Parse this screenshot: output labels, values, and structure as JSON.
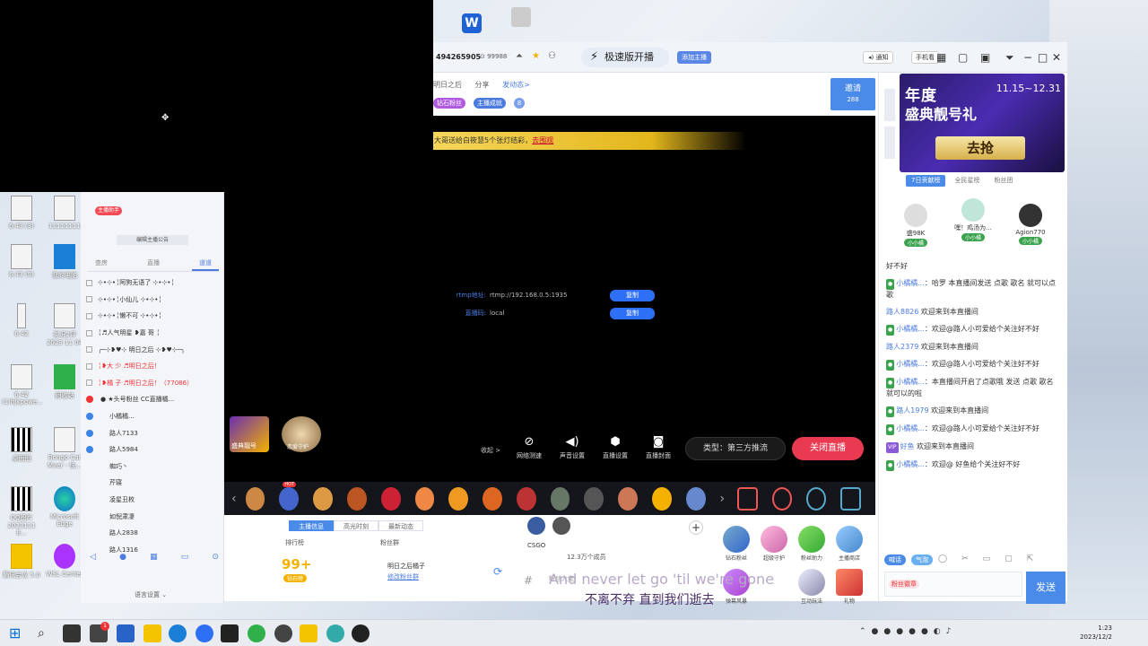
{
  "top_bar": {
    "room_id": "494265905",
    "fans_count": "99988",
    "speed_broadcast": "极速版开播",
    "add_anchor": "添加主播",
    "notice": "通知",
    "phone": "手机看"
  },
  "stream_info": {
    "title": "明日之后",
    "share": "分享",
    "publish": "发动态>",
    "badge_fans": "钻石粉丝",
    "badge_task": "主播成就",
    "badge_count": "8",
    "invite_label": "邀请",
    "invite_count": "288"
  },
  "video": {
    "banner_text": "大哥送给白筱慧5个张灯结彩，",
    "banner_link": "去围观",
    "rtmp_label": "rtmp地址:",
    "rtmp_value": "rtmp://192.168.0.5:1935",
    "key_label": "直播码:",
    "key_value": "local",
    "copy_label": "复制",
    "collapse": "收起 >",
    "controls": [
      {
        "icon": "network-icon",
        "label": "网络测速",
        "glyph": "⊘"
      },
      {
        "icon": "sound-icon",
        "label": "声音设置",
        "glyph": "🔊"
      },
      {
        "icon": "settings-icon",
        "label": "直播设置",
        "glyph": "⬢"
      },
      {
        "icon": "camera-icon",
        "label": "直播封面",
        "glyph": "📷"
      }
    ],
    "type_label": "类型：第三方推流",
    "close_label": "关闭直播",
    "thumb1": "盛典靓号",
    "thumb2": "恋爱守护"
  },
  "lower_panel": {
    "tabs": [
      "主播信息",
      "高光时刻",
      "最新动态"
    ],
    "rank_label": "排行榜",
    "fan_group_label": "粉丝群",
    "rank_value": "99+",
    "rank_tag": "钻石榜",
    "fan_group_name": "明日之后橘子",
    "fan_group_edit": "修改粉丝群",
    "game_label": "CSGO",
    "viewers": "12.3万个成员",
    "fan_name": "粉丝大佬",
    "lyric": "And never let go 'til we're gone",
    "subtitle": "不离不弃 直到我们逝去",
    "features": [
      "钻石粉丝",
      "超级守护",
      "粉丝助力",
      "主播商店",
      "弹幕风暴",
      "互动玩法",
      "礼物"
    ]
  },
  "right_panel": {
    "ad_title1": "年度",
    "ad_title2": "盛典靓号礼",
    "ad_date": "11.15~12.31",
    "ad_button": "去抢",
    "tabs": [
      "7日贡献榜",
      "全民星榜",
      "粉丝团"
    ],
    "top3": [
      {
        "name": "盛98K",
        "rank": "2",
        "level": "小小橘"
      },
      {
        "name": "嘿！鸡汤为...",
        "rank": "3",
        "level": "小小橘"
      },
      {
        "name": "Agion770",
        "rank": "1",
        "level": "小小橘"
      }
    ],
    "messages": [
      {
        "name": "",
        "text": "好不好"
      },
      {
        "name": "小橘橘...",
        "text": "哈罗 本直播间发送 点歌 歌名 就可以点歌"
      },
      {
        "name": "路人8826",
        "text": "欢迎来到本直播间"
      },
      {
        "name": "小橘橘...",
        "text": "欢迎@路人小可爱给个关注好不好"
      },
      {
        "name": "路人2379",
        "text": "欢迎来到本直播间"
      },
      {
        "name": "小橘橘...",
        "text": "欢迎@路人小可爱给个关注好不好"
      },
      {
        "name": "小橘橘...",
        "text": "本直播间开启了点歌哦 发送 点歌 歌名 就可以的啦"
      },
      {
        "name": "路人1979",
        "text": "欢迎来到本直播间"
      },
      {
        "name": "小橘橘...",
        "text": "欢迎@路人小可爱给个关注好不好"
      },
      {
        "name": "好鱼",
        "text": "欢迎来到本直播间"
      },
      {
        "name": "小橘橘...",
        "text": "欢迎@ 好鱼给个关注好不好"
      }
    ],
    "tool_tag1": "喊话",
    "tool_tag2": "气泡",
    "input_tag": "粉丝徽章",
    "send_label": "发送"
  },
  "left_window": {
    "assistant": "主播助手",
    "announcement": "编辑主播公告",
    "tabs": [
      "查房",
      "直播",
      "道道"
    ],
    "users": [
      {
        "text": "⊹•⊹•╎阿狗无语了 ⊹•⊹•╎",
        "type": "check"
      },
      {
        "text": "⊹•⊹•╎小仙儿 ⊹•⊹•╎",
        "type": "check"
      },
      {
        "text": "⊹•⊹•╎懒不可 ⊹•⊹•╎",
        "type": "check"
      },
      {
        "text": "╎♬人气明星 ❥嘉 哥   ╎",
        "type": "check"
      },
      {
        "text": "╭─⊹❥♥⊹ 明日之后 ⊹❥♥⊹─╮",
        "type": "check"
      },
      {
        "text": "╎❥大  少  ♬明日之后！",
        "type": "red"
      },
      {
        "text": "╎❥橘  子  ♬明日之后！（77086）",
        "type": "red"
      },
      {
        "text": "●  ★头号粉丝 CC直播橘...",
        "type": "dot"
      },
      {
        "text": "小橘橘...",
        "type": "dot"
      },
      {
        "text": "路人7133",
        "type": "dot"
      },
      {
        "text": "路人5984",
        "type": "dot"
      },
      {
        "text": "蜘巧丶",
        "type": "pad"
      },
      {
        "text": "芹寝",
        "type": "pad"
      },
      {
        "text": "凌星丑枚",
        "type": "pad"
      },
      {
        "text": "如倪肃凄",
        "type": "pad"
      },
      {
        "text": "路人2838",
        "type": "pad"
      },
      {
        "text": "路人1316",
        "type": "pad"
      }
    ],
    "settings": "语言设置 ⌄"
  },
  "desktop_icons": [
    {
      "label": "6.43 (3)",
      "kind": "doc"
    },
    {
      "label": "11111111",
      "kind": "doc"
    },
    {
      "label": "6.43 (5)",
      "kind": "doc"
    },
    {
      "label": "我的电脑",
      "kind": "blue"
    },
    {
      "label": "6.42",
      "kind": "doc"
    },
    {
      "label": "实况2评 2023 11 04",
      "kind": "doc"
    },
    {
      "label": "6.42 (1)hjkpowe...",
      "kind": "doc"
    },
    {
      "label": "回收站",
      "kind": "green"
    },
    {
      "label": "桌面图",
      "kind": "qr"
    },
    {
      "label": "Bongo Cat Mver - 快...",
      "kind": "doc"
    },
    {
      "label": "QQ图片 2023111 8...",
      "kind": "qr"
    },
    {
      "label": "Microsoft Edge",
      "kind": "edge"
    },
    {
      "label": "腾讯会议 5.0",
      "kind": "yellow"
    },
    {
      "label": "WSL Center",
      "kind": "doc"
    }
  ],
  "taskbar": {
    "time": "1:23",
    "date": "2023/12/2",
    "notif": "1"
  }
}
